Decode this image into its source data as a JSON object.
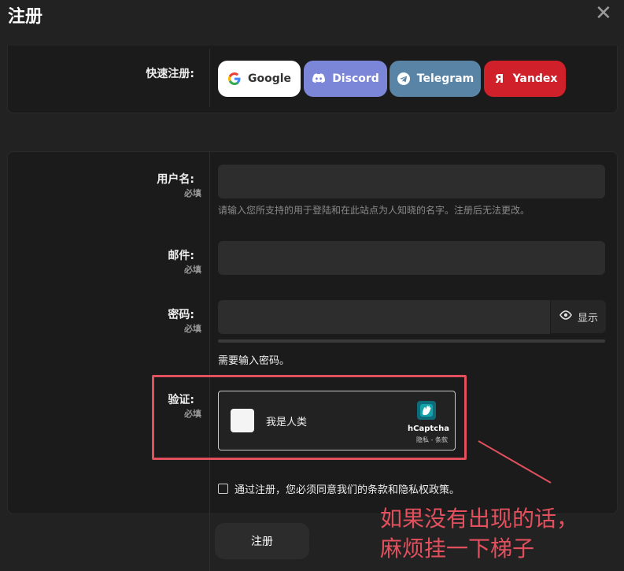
{
  "dialog": {
    "title": "注册",
    "close_symbol": "✕"
  },
  "quick_register": {
    "label": "快速注册:",
    "buttons": [
      {
        "name": "Google",
        "bg": "#ffffff",
        "fg": "#333333"
      },
      {
        "name": "Discord",
        "bg": "#7b86d8",
        "fg": "#ffffff"
      },
      {
        "name": "Telegram",
        "bg": "#5a84a6",
        "fg": "#ffffff"
      },
      {
        "name": "Yandex",
        "bg": "#d0202a",
        "fg": "#ffffff"
      }
    ]
  },
  "form": {
    "username": {
      "label": "用户名:",
      "required": "必填",
      "value": "",
      "hint": "请输入您所支持的用于登陆和在此站点为人知晓的名字。注册后无法更改。"
    },
    "email": {
      "label": "邮件:",
      "required": "必填",
      "value": ""
    },
    "password": {
      "label": "密码:",
      "required": "必填",
      "value": "",
      "show_label": "显示",
      "message": "需要输入密码。"
    },
    "verify": {
      "label": "验证:",
      "required": "必填"
    }
  },
  "captcha": {
    "text": "我是人类",
    "brand": "hCaptcha",
    "links": "隐私 - 条款"
  },
  "agreement": {
    "text": "通过注册，您必须同意我们的条款和隐私权政策。"
  },
  "submit": {
    "label": "注册"
  },
  "annotation": {
    "line1": "如果没有出现的话，",
    "line2": "麻烦挂一下梯子",
    "color": "#e2505e"
  }
}
